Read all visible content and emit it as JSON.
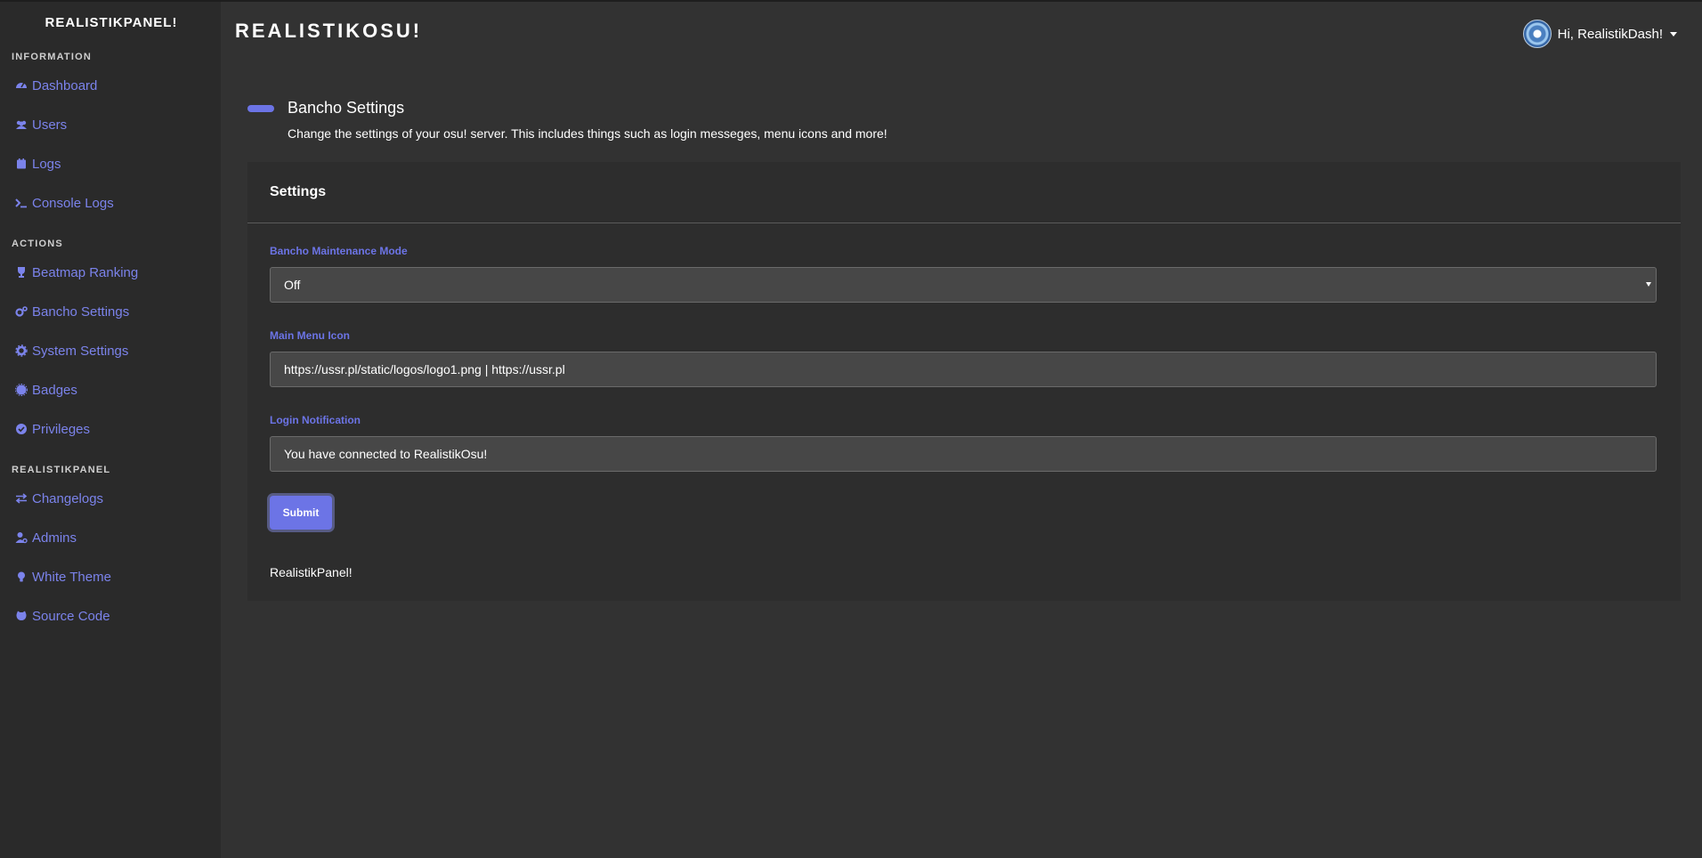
{
  "sidebar": {
    "brand": "REALISTIKPANEL!",
    "sections": [
      {
        "heading": "INFORMATION",
        "items": [
          {
            "label": "Dashboard",
            "icon": "gauge-icon"
          },
          {
            "label": "Users",
            "icon": "users-icon"
          },
          {
            "label": "Logs",
            "icon": "calendar-icon"
          },
          {
            "label": "Console Logs",
            "icon": "terminal-icon"
          }
        ]
      },
      {
        "heading": "ACTIONS",
        "items": [
          {
            "label": "Beatmap Ranking",
            "icon": "trophy-icon"
          },
          {
            "label": "Bancho Settings",
            "icon": "cogs-icon"
          },
          {
            "label": "System Settings",
            "icon": "gear-icon"
          },
          {
            "label": "Badges",
            "icon": "certificate-icon"
          },
          {
            "label": "Privileges",
            "icon": "check-circle-icon"
          }
        ]
      },
      {
        "heading": "REALISTIKPANEL",
        "items": [
          {
            "label": "Changelogs",
            "icon": "exchange-icon"
          },
          {
            "label": "Admins",
            "icon": "user-cog-icon"
          },
          {
            "label": "White Theme",
            "icon": "lightbulb-icon"
          },
          {
            "label": "Source Code",
            "icon": "github-icon"
          }
        ]
      }
    ]
  },
  "topbar": {
    "site_title": "REALISTIKOSU!",
    "greeting": "Hi, RealistikDash!"
  },
  "page": {
    "title": "Bancho Settings",
    "description": "Change the settings of your osu! server. This includes things such as login messeges, menu icons and more!"
  },
  "card": {
    "header": "Settings",
    "maintenance_label": "Bancho Maintenance Mode",
    "maintenance_value": "Off",
    "menu_icon_label": "Main Menu Icon",
    "menu_icon_value": "https://ussr.pl/static/logos/logo1.png | https://ussr.pl",
    "login_notif_label": "Login Notification",
    "login_notif_value": "You have connected to RealistikOsu!",
    "submit_label": "Submit",
    "footer": "RealistikPanel!"
  },
  "colors": {
    "accent": "#6c74e6",
    "link": "#7b83eb",
    "background": "#323232",
    "sidebar": "#2a2a2a"
  }
}
